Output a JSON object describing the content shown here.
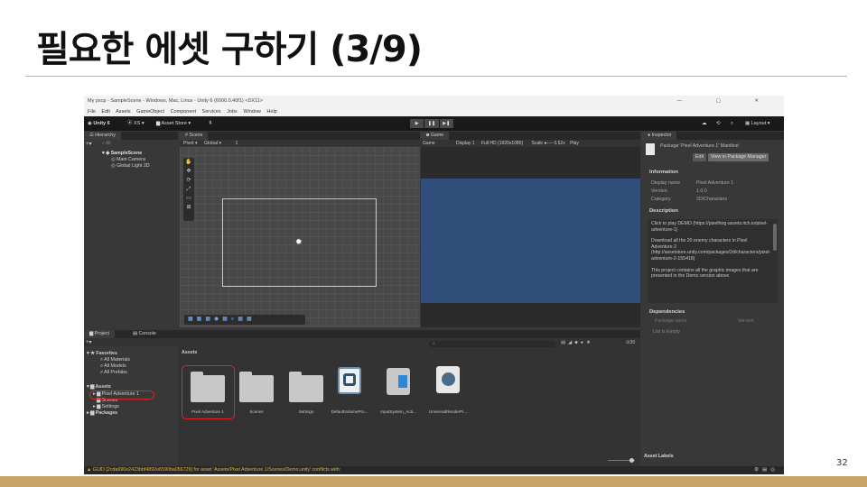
{
  "slide": {
    "title": "필요한 에셋 구하기 (3/9)",
    "page_number": "32"
  },
  "window": {
    "title": "My pscp - SampleScene - Windows, Mac, Linux - Unity 6 (6000.0.40f1) <DX11>",
    "controls": "—   ▢   ✕"
  },
  "menubar": [
    "File",
    "Edit",
    "Assets",
    "GameObject",
    "Component",
    "Services",
    "Jobs",
    "Window",
    "Help"
  ],
  "toolbar": {
    "unity_label": "Unity 6",
    "account_label": "XS ▾",
    "asset_store_label": "Asset Store ▾",
    "layout_label": "Layout ▾",
    "play_buttons": [
      "▶",
      "❚❚",
      "▶❚"
    ]
  },
  "hierarchy": {
    "tab_label": "Hierarchy",
    "search_placeholder": "All",
    "items": [
      "SampleScene",
      "Main Camera",
      "Global Light 2D"
    ]
  },
  "scene": {
    "tab_label": "Scene",
    "pivot_label": "Pivot ▾",
    "global_label": "Global ▾",
    "snap_value": "1"
  },
  "game": {
    "tab_label": "Game",
    "mode_label": "Game",
    "display_label": "Display 1",
    "resolution_label": "Full HD (1920x1080)",
    "scale_label": "Scale ●---- 0.52x",
    "play_label": "Play"
  },
  "inspector": {
    "tab_label": "Inspector",
    "package_title": "Package 'Pixel Adventure 1' Manifest",
    "edit_button": "Edit",
    "view_button": "View in Package Manager",
    "information_header": "Information",
    "info_rows": [
      {
        "key": "Display name",
        "value": "Pixel Adventure 1"
      },
      {
        "key": "Version",
        "value": "1.0.0"
      },
      {
        "key": "Category",
        "value": "2D/Characters"
      }
    ],
    "description_header": "Description",
    "description_paragraphs": [
      "Click to play DEMO (https://pixelfrog-assets.itch.io/pixel-adventure-1)",
      "Download all the 20 enemy characters in Pixel Adventure 2 (http://assetstore.unity.com/packages/2d/characters/pixel-adventure-2-155418)",
      "This project contains all the graphic images that are presented in the Demo version above."
    ],
    "dependencies_header": "Dependencies",
    "dep_columns": [
      "Package name",
      "Version"
    ],
    "dep_empty": "List is Empty",
    "asset_labels": "Asset Labels"
  },
  "project": {
    "tabs": [
      "Project",
      "Console"
    ],
    "favorites_header": "Favorites",
    "favorites": [
      "All Materials",
      "All Models",
      "All Prefabs"
    ],
    "assets_header": "Assets",
    "asset_tree": [
      "Pixel Adventure 1",
      "Scenes",
      "Settings"
    ],
    "packages_header": "Packages",
    "breadcrumb": "Assets",
    "hidden_count": "30",
    "assets": [
      {
        "name": "Pixel Adventure 1",
        "kind": "folder"
      },
      {
        "name": "Scenes",
        "kind": "folder"
      },
      {
        "name": "Settings",
        "kind": "folder"
      },
      {
        "name": "DefaultVolumePro...",
        "kind": "volume-profile-icon"
      },
      {
        "name": "InputSystem_Acti...",
        "kind": "input-actions-icon"
      },
      {
        "name": "UniversalRenderPi...",
        "kind": "render-pipeline-icon"
      }
    ]
  },
  "status_bar": {
    "message": "GUID [2cda990e2423bbf4892e6590ba056729] for asset 'Assets/Pixel Adventure 1/Scenes/Demo.unity' conflicts with:"
  },
  "colors": {
    "highlight": "#e0242b",
    "game_view": "#314d79",
    "footer_band": "#c9a56b",
    "warning": "#e8b437"
  }
}
